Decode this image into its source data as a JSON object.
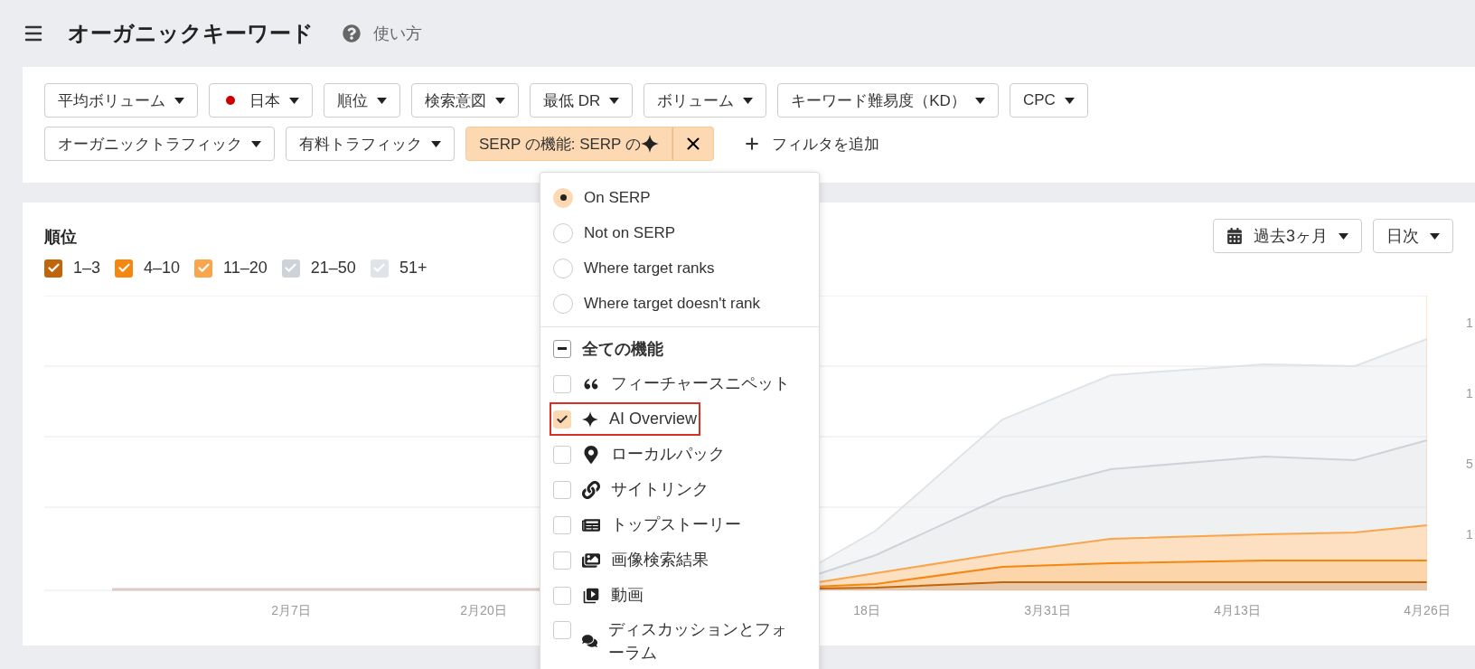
{
  "header": {
    "title": "オーガニックキーワード",
    "help": "使い方"
  },
  "filters": {
    "row_1": [
      {
        "label": "平均ボリューム",
        "flag": false
      },
      {
        "label": "日本",
        "flag": true
      },
      {
        "label": "順位",
        "flag": false
      },
      {
        "label": "検索意図",
        "flag": false
      },
      {
        "label": "最低 DR",
        "flag": false
      },
      {
        "label": "ボリューム",
        "flag": false
      },
      {
        "label": "キーワード難易度（KD）",
        "flag": false
      },
      {
        "label": "CPC",
        "flag": false
      }
    ],
    "row_2": [
      {
        "label": "オーガニックトラフィック",
        "active": false
      },
      {
        "label": "有料トラフィック",
        "active": false
      },
      {
        "label": "SERP の機能: SERP の",
        "active": true
      }
    ],
    "add_filter": "フィルタを追加"
  },
  "dropdown": {
    "options": [
      {
        "label": "On SERP",
        "selected": true
      },
      {
        "label": "Not on SERP",
        "selected": false
      },
      {
        "label": "Where target ranks",
        "selected": false
      },
      {
        "label": "Where target doesn't rank",
        "selected": false
      }
    ],
    "all_features": {
      "label": "全ての機能",
      "indeterminate": true
    },
    "features": [
      {
        "label": "フィーチャースニペット",
        "checked": false,
        "highlighted": false
      },
      {
        "label": "AI Overview",
        "checked": true,
        "highlighted": true
      },
      {
        "label": "ローカルパック",
        "checked": false,
        "highlighted": false
      },
      {
        "label": "サイトリンク",
        "checked": false,
        "highlighted": false
      },
      {
        "label": "トップストーリー",
        "checked": false,
        "highlighted": false
      },
      {
        "label": "画像検索結果",
        "checked": false,
        "highlighted": false
      },
      {
        "label": "動画",
        "checked": false,
        "highlighted": false
      },
      {
        "label": "ディスカッションとフォーラム",
        "checked": false,
        "highlighted": false
      }
    ]
  },
  "chart": {
    "title": "順位",
    "period": "過去3ヶ月",
    "interval": "日次",
    "legend": [
      {
        "label": "1–3",
        "checked": true,
        "color": "#c0650c"
      },
      {
        "label": "4–10",
        "checked": true,
        "color": "#f5870f"
      },
      {
        "label": "11–20",
        "checked": true,
        "color": "#f8a54c"
      },
      {
        "label": "21–50",
        "checked": true,
        "color": "#cdd3d9"
      },
      {
        "label": "51+",
        "checked": true,
        "color": "#e0e3e7"
      }
    ],
    "x_labels": [
      "2月7日",
      "2月20日",
      "18日",
      "3月31日",
      "4月13日",
      "4月26日"
    ],
    "y_labels": [
      "1",
      "1",
      "5",
      "1"
    ]
  }
}
